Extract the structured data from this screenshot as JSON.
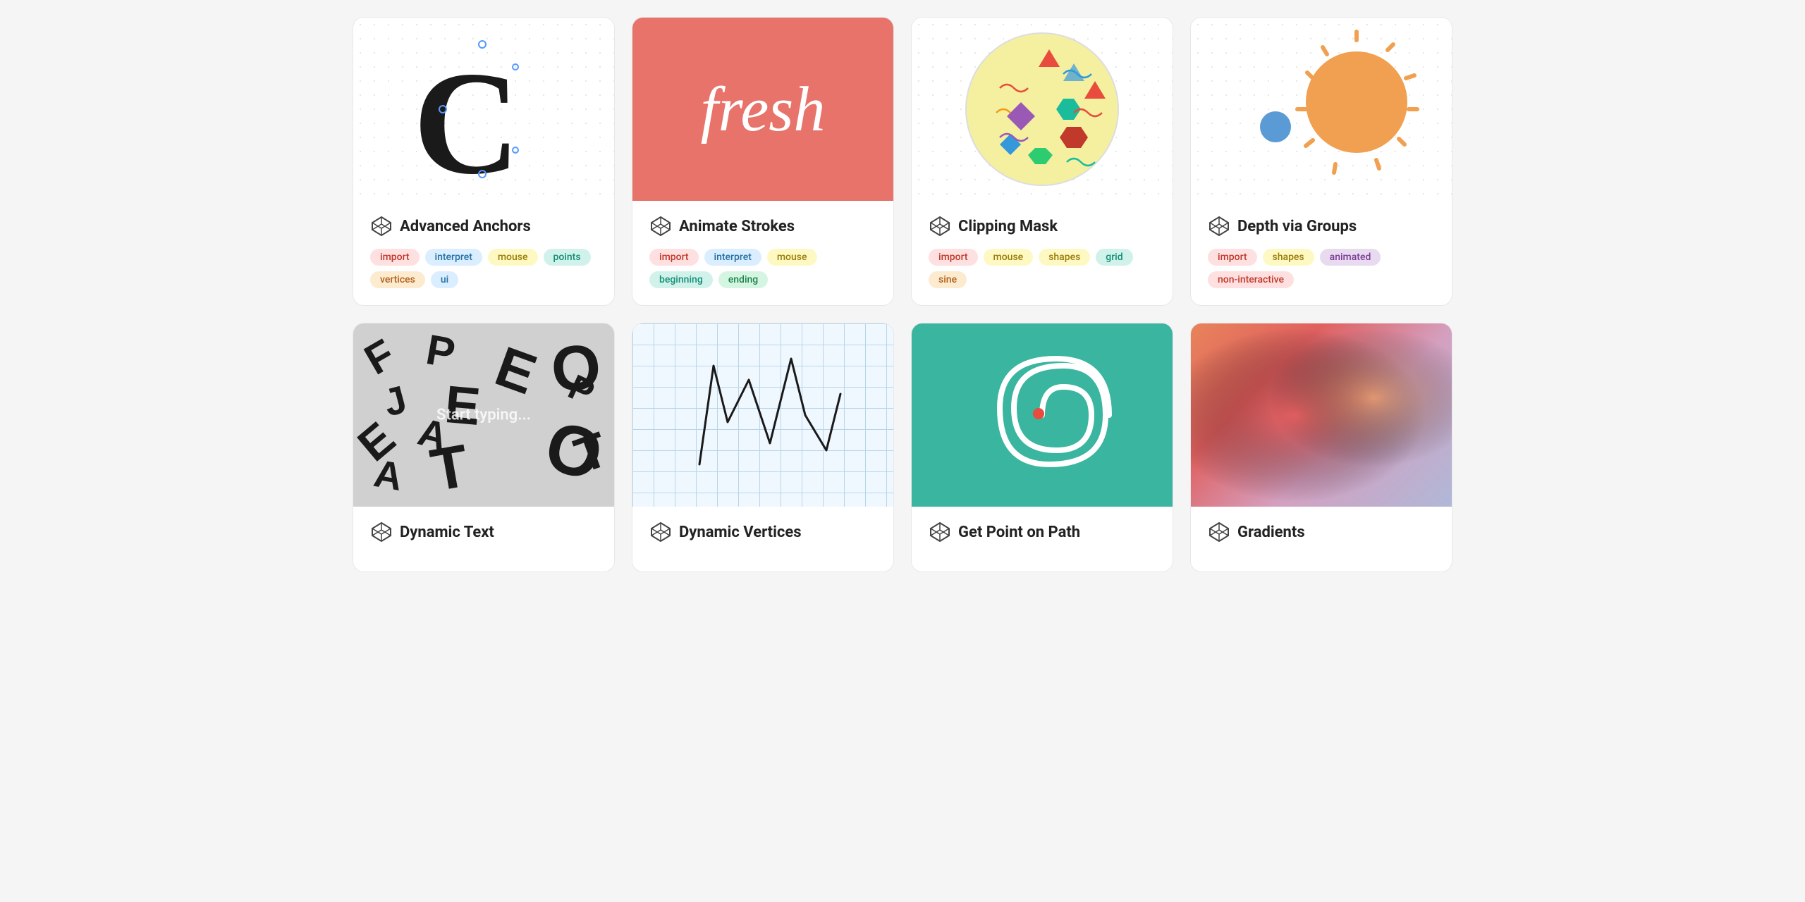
{
  "cards": [
    {
      "id": "advanced-anchors",
      "title": "Advanced Anchors",
      "tags": [
        {
          "label": "import",
          "color": "pink"
        },
        {
          "label": "interpret",
          "color": "blue"
        },
        {
          "label": "mouse",
          "color": "yellow"
        },
        {
          "label": "points",
          "color": "teal"
        },
        {
          "label": "vertices",
          "color": "orange"
        },
        {
          "label": "ui",
          "color": "blue"
        }
      ]
    },
    {
      "id": "animate-strokes",
      "title": "Animate Strokes",
      "tags": [
        {
          "label": "import",
          "color": "pink"
        },
        {
          "label": "interpret",
          "color": "blue"
        },
        {
          "label": "mouse",
          "color": "yellow"
        },
        {
          "label": "beginning",
          "color": "teal"
        },
        {
          "label": "ending",
          "color": "green"
        }
      ]
    },
    {
      "id": "clipping-mask",
      "title": "Clipping Mask",
      "tags": [
        {
          "label": "import",
          "color": "pink"
        },
        {
          "label": "mouse",
          "color": "yellow"
        },
        {
          "label": "shapes",
          "color": "yellow"
        },
        {
          "label": "grid",
          "color": "teal"
        },
        {
          "label": "sine",
          "color": "orange"
        }
      ]
    },
    {
      "id": "depth-via-groups",
      "title": "Depth via Groups",
      "tags": [
        {
          "label": "import",
          "color": "pink"
        },
        {
          "label": "shapes",
          "color": "yellow"
        },
        {
          "label": "animated",
          "color": "purple"
        },
        {
          "label": "non-interactive",
          "color": "pink"
        }
      ]
    },
    {
      "id": "dynamic-text",
      "title": "Dynamic Text",
      "tags": []
    },
    {
      "id": "dynamic-vertices",
      "title": "Dynamic Vertices",
      "tags": []
    },
    {
      "id": "get-point-on-path",
      "title": "Get Point on Path",
      "tags": []
    },
    {
      "id": "gradients",
      "title": "Gradients",
      "tags": []
    }
  ]
}
